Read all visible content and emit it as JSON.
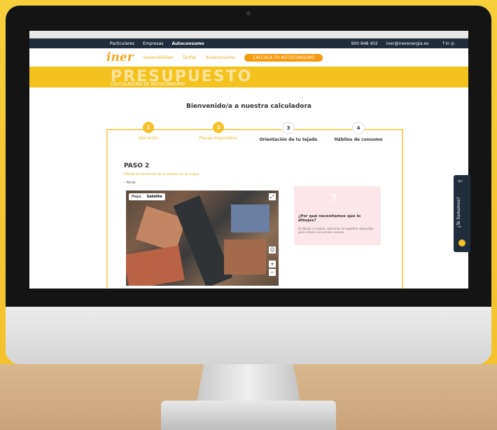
{
  "nav": {
    "items": [
      "Particulares",
      "Empresas",
      "Autoconsumo"
    ],
    "phone": "900 848 402",
    "email": "iner@inerenergia.es",
    "social": "f  in  ◎"
  },
  "header": {
    "logo": "iner",
    "links": [
      "Sostenibilidad",
      "Tarifas",
      "Autoconsumo"
    ],
    "cta": "CALCULA TU AUTOCONSUMO"
  },
  "hero": {
    "title": "PRESUPUESTO",
    "subtitle": "CALCULADORA DE AUTOCONSUMO"
  },
  "page": {
    "welcome": "Bienvenido/a a nuestra calculadora",
    "steps": [
      {
        "num": "1",
        "label": "Ubicación",
        "active": true
      },
      {
        "num": "2",
        "label": "Placas disponibles",
        "active": true
      },
      {
        "num": "3",
        "label": "Orientación de tu tejado",
        "active": false
      },
      {
        "num": "4",
        "label": "Hábitos de consumo",
        "active": false
      }
    ],
    "step_title": "PASO 2",
    "step_subtitle": "Dibuja el contorno de tu tejado en el mapa",
    "back": "Atrás",
    "map_toggle": [
      "Mapa",
      "Satélite"
    ],
    "info_title": "¿Por qué necesitamos que lo dibujes?",
    "info_text": "Al dibujar tu tejado, sabremos la superficie disponible para instalar tus paneles solares."
  },
  "side_tab": {
    "label": "¿Te llamamos?"
  }
}
